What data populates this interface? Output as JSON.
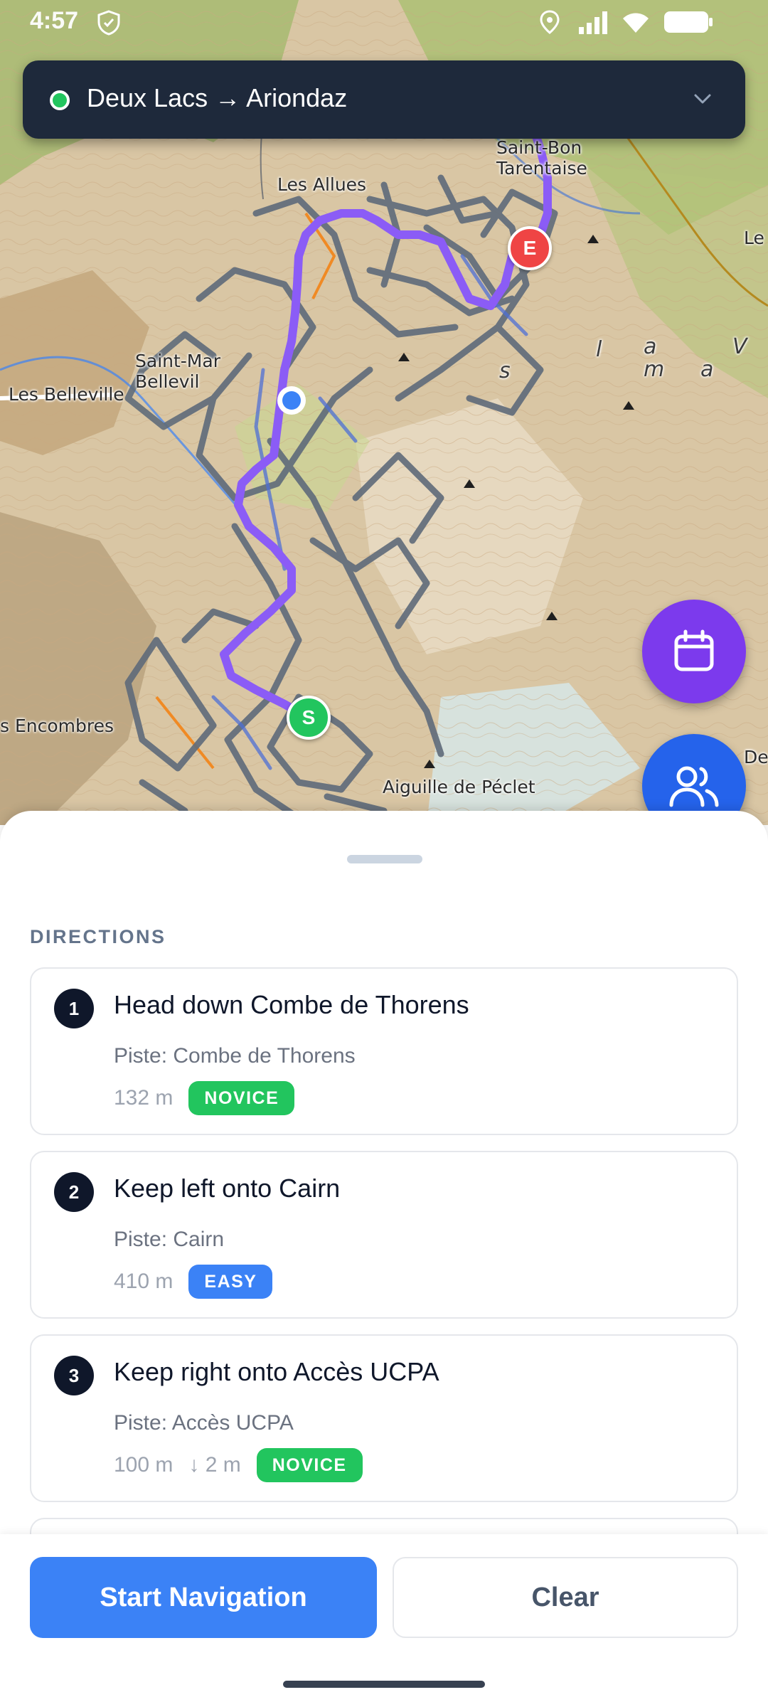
{
  "status_bar": {
    "time": "4:57"
  },
  "route": {
    "title": "Deux Lacs → Ariondaz",
    "status_color": "#22c55e"
  },
  "map": {
    "labels": {
      "saint_bon": "Saint-Bon",
      "tarentaise": "Tarentaise",
      "les_allues": "Les Allues",
      "saint_martin": "Saint-Mar",
      "belleville_frag": "Bellevil",
      "les_belleville": "Les Belleville",
      "encombres": "s Encombres",
      "aiguille": "Aiguille de Péclet",
      "right_le": "Le",
      "right_de": "De",
      "v_letter": "V",
      "l_letter": "l",
      "a_letter": "a",
      "m_letter": "m",
      "a2_letter": "a",
      "s_letter": "s"
    },
    "markers": {
      "start": "S",
      "end": "E"
    },
    "route_color": "#8b5cf6"
  },
  "fabs": {
    "calendar_icon": "calendar-icon",
    "friends_icon": "users-icon"
  },
  "sheet": {
    "heading": "DIRECTIONS",
    "steps": [
      {
        "number": "1",
        "title": "Head down Combe de Thorens",
        "piste": "Piste: Combe de Thorens",
        "distance": "132 m",
        "drop": "",
        "level": "NOVICE",
        "level_color": "#22c55e"
      },
      {
        "number": "2",
        "title": "Keep left onto Cairn",
        "piste": "Piste: Cairn",
        "distance": "410 m",
        "drop": "",
        "level": "EASY",
        "level_color": "#3b82f6"
      },
      {
        "number": "3",
        "title": "Keep right onto Accès UCPA",
        "piste": "Piste: Accès UCPA",
        "distance": "100 m",
        "drop": "↓ 2 m",
        "level": "NOVICE",
        "level_color": "#22c55e"
      }
    ]
  },
  "actions": {
    "start_label": "Start Navigation",
    "clear_label": "Clear"
  },
  "colors": {
    "primary": "#3b82f6",
    "calendar_fab": "#7c3aed",
    "friends_fab": "#2563eb",
    "header_bg": "#1e293b"
  }
}
